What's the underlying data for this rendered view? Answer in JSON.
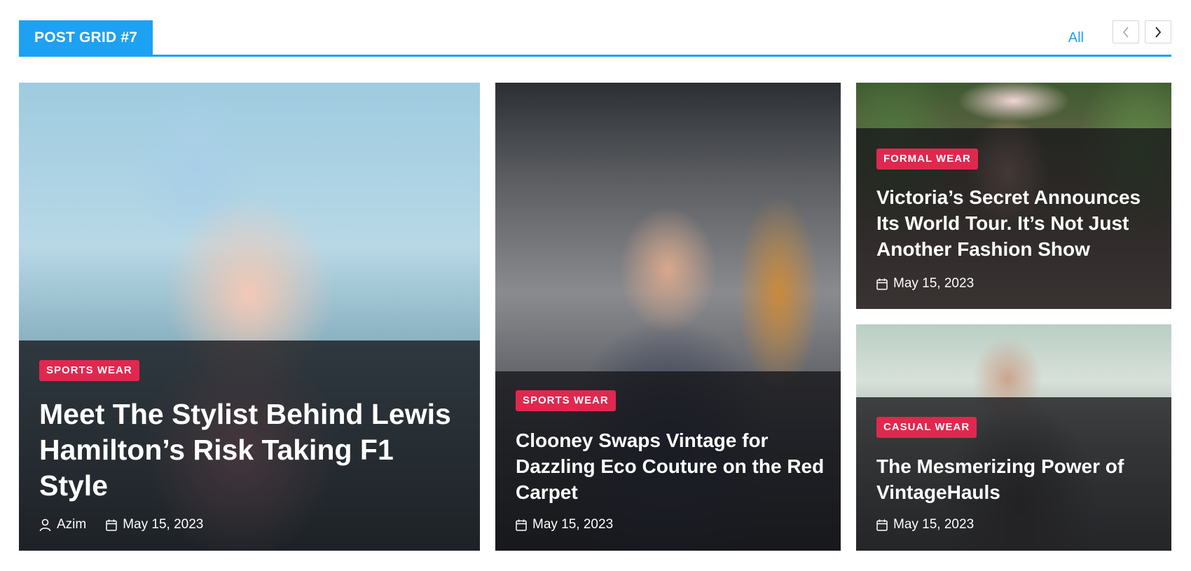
{
  "header": {
    "title": "POST GRID #7",
    "all_label": "All",
    "accent_color": "#1da1f2",
    "prev_icon": "chevron-left-icon",
    "next_icon": "chevron-right-icon"
  },
  "category_color": "#e0284f",
  "posts": [
    {
      "category": "SPORTS WEAR",
      "title": "Meet The Stylist Behind Lewis Hamilton’s Risk Taking F1 Style",
      "author": "Azim",
      "date": "May 15, 2023",
      "image": "girl-with-bunny-ears-photo"
    },
    {
      "category": "SPORTS WEAR",
      "title": "Clooney Swaps Vintage for Dazzling Eco Couture on the Red Carpet",
      "date": "May 15, 2023",
      "image": "man-with-glasses-photo"
    },
    {
      "category": "FORMAL WEAR",
      "title": "Victoria’s Secret Announces Its World Tour. It’s Not Just Another Fashion Show",
      "date": "May 15, 2023",
      "image": "girl-with-flower-crown-photo"
    },
    {
      "category": "CASUAL WEAR",
      "title": "The Mesmerizing Power of VintageHauls",
      "date": "May 15, 2023",
      "image": "bearded-man-with-phone-photo"
    }
  ]
}
